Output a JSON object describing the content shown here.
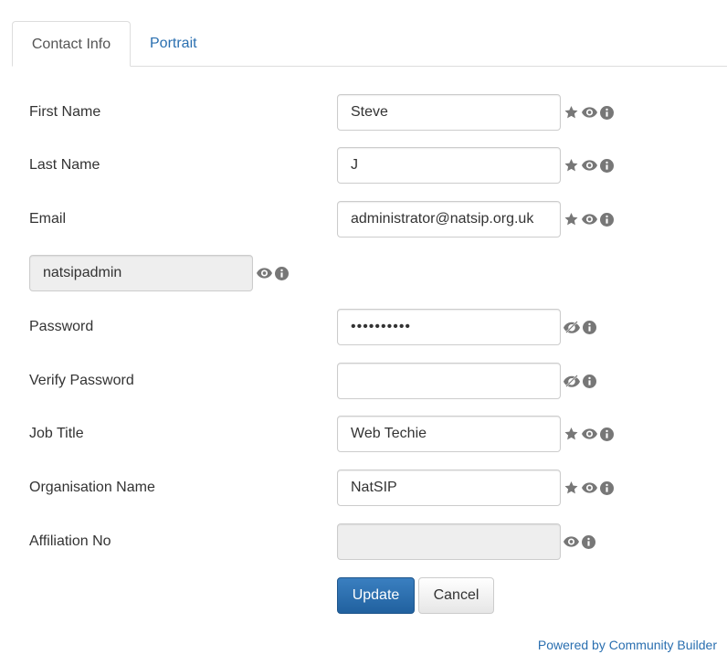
{
  "tabs": {
    "contact_info": "Contact Info",
    "portrait": "Portrait"
  },
  "fields": {
    "first_name": {
      "label": "First Name",
      "value": "Steve"
    },
    "last_name": {
      "label": "Last Name",
      "value": "J"
    },
    "email": {
      "label": "Email",
      "value": "administrator@natsip.org.uk"
    },
    "username": {
      "value": "natsipadmin"
    },
    "password": {
      "label": "Password",
      "value": "••••••••••"
    },
    "verify_password": {
      "label": "Verify Password",
      "value": ""
    },
    "job_title": {
      "label": "Job Title",
      "value": "Web Techie"
    },
    "organisation_name": {
      "label": "Organisation Name",
      "value": "NatSIP"
    },
    "affiliation_no": {
      "label": "Affiliation No",
      "value": ""
    }
  },
  "buttons": {
    "update": "Update",
    "cancel": "Cancel"
  },
  "footer": {
    "link_text": "Powered by Community Builder"
  },
  "icons": {
    "required": "star-icon",
    "visible": "eye-icon",
    "hidden": "eye-slash-icon",
    "info": "info-icon",
    "color": "#777777"
  },
  "colors": {
    "link": "#2a6fb0",
    "primary": "#2c6ea8",
    "disabled_bg": "#eeeeee"
  }
}
